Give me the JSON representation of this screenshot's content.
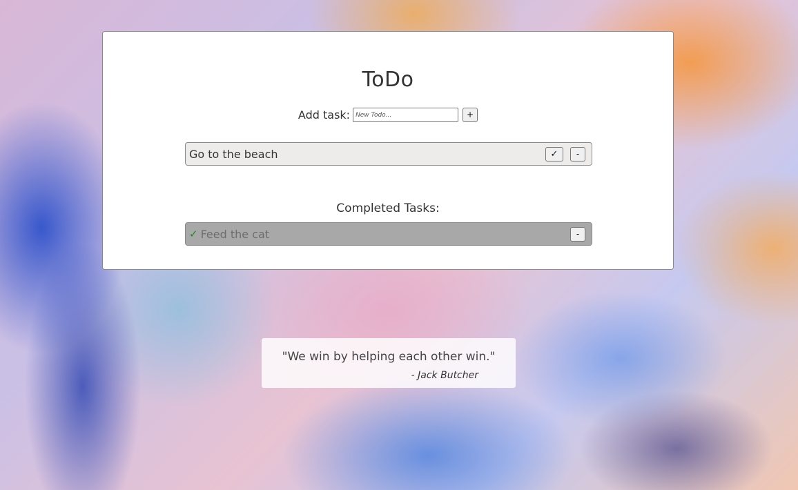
{
  "app": {
    "title": "ToDo"
  },
  "add_task": {
    "label": "Add task:",
    "input_value": "",
    "placeholder": "New Todo...",
    "add_button_label": "+"
  },
  "open_tasks": [
    {
      "text": "Go to the beach",
      "complete_button_label": "✓",
      "remove_button_label": "-"
    }
  ],
  "completed": {
    "heading": "Completed Tasks:",
    "tasks": [
      {
        "check_glyph": "✓",
        "text": "Feed the cat",
        "remove_button_label": "-"
      }
    ]
  },
  "quote": {
    "text": "\"We win by helping each other win.\"",
    "author": "- Jack Butcher"
  },
  "colors": {
    "card_background": "#ffffff",
    "open_task_background": "#eeebeb",
    "completed_task_background": "#a9a8a8",
    "check_green": "#1f8a1f"
  },
  "icons": {
    "complete": "check-icon",
    "completed_marker": "check-mark-icon"
  }
}
